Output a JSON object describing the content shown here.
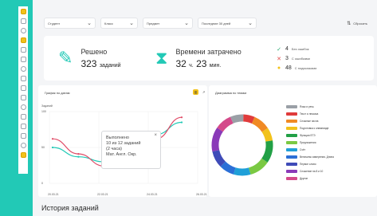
{
  "sidebar": {
    "icons": [
      "logo-icon",
      "clock-icon",
      "refresh-icon",
      "pencil-icon",
      "user-icon",
      "chart-icon",
      "list-icon",
      "book-icon",
      "settings-icon",
      "grid-icon",
      "doc-icon",
      "chat-icon",
      "calendar-icon",
      "help-icon",
      "circle-icon",
      "star-icon"
    ]
  },
  "filters": {
    "student": "Студент",
    "class": "Класс",
    "subject": "Предмет",
    "period": "Последние 30 дней",
    "export_label": "Сбросить"
  },
  "stats": {
    "solved_label": "Решено",
    "solved_value": "323",
    "solved_unit": "заданий",
    "time_label": "Времени затрачено",
    "time_hours": "32",
    "time_hours_unit": "ч.",
    "time_minutes": "23",
    "time_minutes_unit": "мин.",
    "results": [
      {
        "icon": "check-icon",
        "color": "#22a46b",
        "count": "4",
        "label": "Без ошибок"
      },
      {
        "icon": "cross-icon",
        "color": "#e04b4b",
        "count": "3",
        "label": "С ошибками"
      },
      {
        "icon": "bulb-icon",
        "color": "#f2c21b",
        "count": "48",
        "label": "С подсказками"
      }
    ]
  },
  "line_panel": {
    "title": "График по датам",
    "tooltip": {
      "line1": "Выполнено",
      "line2": "10 из 12 заданий",
      "line3": "(2 часа)",
      "line4": "Мат. Англ. Окр."
    }
  },
  "donut_panel": {
    "title": "Диаграмма по темам"
  },
  "history": {
    "title": "История заданий"
  },
  "chart_data": [
    {
      "type": "line",
      "title": "График по датам",
      "ylabel": "Заданий",
      "ylim": [
        0,
        100
      ],
      "yticks": [
        "100",
        "50",
        "0"
      ],
      "x": [
        "20.03.21",
        "22.03.21",
        "24.03.21",
        "26.03.21"
      ],
      "series": [
        {
          "color": "#22c9b6",
          "values": [
            50,
            37,
            30,
            42,
            68,
            85
          ]
        },
        {
          "color": "#e04b67",
          "values": [
            62,
            41,
            24,
            32,
            62,
            92
          ]
        }
      ]
    },
    {
      "type": "pie",
      "title": "Диаграмма по темам",
      "series": [
        {
          "name": "Язык и речь",
          "color": "#9aa0a6",
          "value": 7
        },
        {
          "name": "Текст и лексика",
          "color": "#e03b3b",
          "value": 6
        },
        {
          "name": "Сложные числа",
          "color": "#f08a24",
          "value": 9
        },
        {
          "name": "Подготовка к олимпиаде",
          "color": "#f2c21b",
          "value": 7
        },
        {
          "name": "Функции ЕГЭ",
          "color": "#22a046",
          "value": 12
        },
        {
          "name": "Предложения",
          "color": "#7ac943",
          "value": 11
        },
        {
          "name": "Счёт",
          "color": "#1f9fd8",
          "value": 9
        },
        {
          "name": "Величины измерения. Длина",
          "color": "#2b6fd6",
          "value": 8
        },
        {
          "name": "Первое слово",
          "color": "#3f4bb8",
          "value": 9
        },
        {
          "name": "Сложение на 8 и 10",
          "color": "#8a3ab8",
          "value": 13
        },
        {
          "name": "Другие",
          "color": "#d44a8a",
          "value": 9
        }
      ]
    }
  ]
}
